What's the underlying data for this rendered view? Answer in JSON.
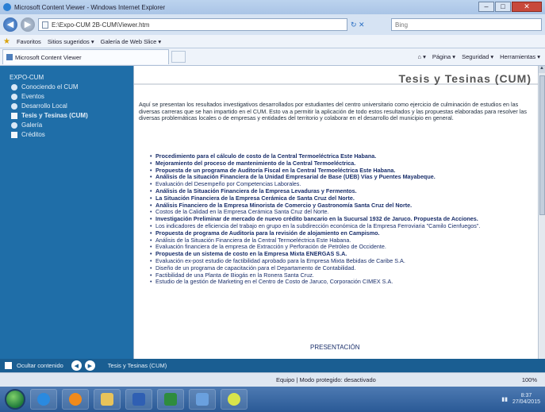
{
  "window": {
    "title": "Microsoft Content Viewer - Windows Internet Explorer",
    "controls": [
      "–",
      "□",
      "✕"
    ]
  },
  "address": {
    "url": "E:\\Expo-CUM 2B-CUM\\Viewer.htm",
    "search_placeholder": "Bing"
  },
  "favorites": {
    "label": "Favoritos",
    "items": [
      "Sitios sugeridos ▾",
      "Galería de Web Slice ▾"
    ]
  },
  "tab": {
    "label": "Microsoft Content Viewer"
  },
  "commands": [
    "Página ▾",
    "Seguridad ▾",
    "Herramientas ▾"
  ],
  "sidebar": {
    "title": "EXPO-CUM",
    "items": [
      {
        "label": "Conociendo el CUM",
        "icon": "globe-icon"
      },
      {
        "label": "Eventos",
        "icon": "globe-icon"
      },
      {
        "label": "Desarrollo Local",
        "icon": "globe-icon"
      },
      {
        "label": "Tesis y Tesinas (CUM)",
        "icon": "document-icon"
      },
      {
        "label": "Galería",
        "icon": "globe-icon"
      },
      {
        "label": "Créditos",
        "icon": "document-icon"
      }
    ]
  },
  "content": {
    "title": "Tesis y Tesinas (CUM)",
    "intro": "Aquí se presentan los resultados investigativos desarrollados por estudiantes del centro universitario como ejercicio de culminación de estudios en las diversas carreras que se han impartido en el CUM. Esto va a permitir la aplicación de todo estos resultados y las propuestas elaboradas para resolver las diversas problemáticas locales o de empresas y entidades del territorio y colaborar en el desarrollo del municipio en general.",
    "items": [
      {
        "text": "Procedimiento para el cálculo de costo de la Central Termoeléctrica Este Habana.",
        "bold": true
      },
      {
        "text": "Mejoramiento del proceso de mantenimiento de la Central Termoeléctrica.",
        "bold": true
      },
      {
        "text": "Propuesta de un programa de Auditoría Fiscal en la Central Termoeléctrica Este Habana.",
        "bold": true
      },
      {
        "text": "Análisis de la situación Financiera de la Unidad Empresarial de Base (UEB) Vías y Puentes Mayabeque.",
        "bold": true
      },
      {
        "text": "Evaluación del Desempeño por Competencias Laborales.",
        "bold": false
      },
      {
        "text": "Análisis de la Situación Financiera de la Empresa Levaduras y Fermentos.",
        "bold": true
      },
      {
        "text": "La Situación Financiera de la Empresa Cerámica de Santa Cruz del Norte.",
        "bold": true
      },
      {
        "text": "Análisis Financiero de la Empresa Minorista de Comercio y Gastronomía Santa Cruz del Norte.",
        "bold": true
      },
      {
        "text": "Costos de la Calidad en la Empresa Cerámica Santa Cruz del Norte.",
        "bold": false
      },
      {
        "text": "Investigación Preliminar de mercado de nuevo crédito bancario en la Sucursal 1932 de Jaruco. Propuesta de Acciones.",
        "bold": true
      },
      {
        "text": "Los indicadores de eficiencia del trabajo en grupo en la subdirección económica de la Empresa Ferroviaria \"Camilo Cienfuegos\".",
        "bold": false
      },
      {
        "text": "Propuesta de programa de Auditoría para la revisión de alojamiento en Campismo.",
        "bold": true
      },
      {
        "text": "Análisis de la Situación Financiera de la Central Termoeléctrica Este Habana.",
        "bold": false
      },
      {
        "text": "Evaluación financiera de la empresa de Extracción y Perforación de Petróleo de Occidente.",
        "bold": false
      },
      {
        "text": "Propuesta de un sistema de costo en la Empresa Mixta ENERGAS S.A.",
        "bold": true
      },
      {
        "text": "Evaluación ex-post estudio de factibilidad aprobado para la Empresa Mixta Bebidas de Caribe S.A.",
        "bold": false
      },
      {
        "text": "Diseño de un programa de capacitación para el Departamento de Contabilidad.",
        "bold": false
      },
      {
        "text": "Factibilidad de una Planta de Biogás en la Ronera Santa Cruz.",
        "bold": false
      },
      {
        "text": "Estudio de la gestión de Marketing en el Centro de Costo de Jaruco, Corporación CIMEX S.A.",
        "bold": false
      }
    ],
    "presentation_link": "PRESENTACIÓN"
  },
  "navstrip": {
    "hide_label": "Ocultar contenido",
    "location": "Tesis y Tesinas (CUM)"
  },
  "status": {
    "protection": "Equipo | Modo protegido: desactivado",
    "zoom": "100%"
  },
  "taskbar": {
    "apps": [
      "ie",
      "folder",
      "media",
      "word",
      "excel",
      "explorer",
      "paint"
    ],
    "clock": "8:37",
    "date": "27/04/2015",
    "colors": {
      "accent": "#1f6ea8",
      "taskbar": "#2a5a96"
    }
  }
}
